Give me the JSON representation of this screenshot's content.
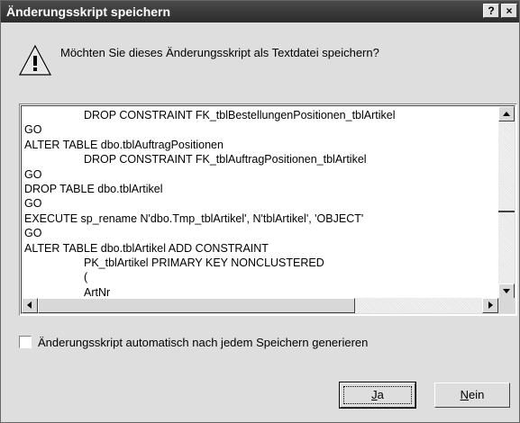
{
  "dialog": {
    "title": "Änderungsskript speichern",
    "help_label": "?",
    "close_label": "×",
    "message": "Möchten Sie dieses Änderungsskript als Textdatei speichern?"
  },
  "script_lines": [
    {
      "text": "DROP CONSTRAINT FK_tblBestellungenPositionen_tblArtikel",
      "indent": true
    },
    {
      "text": "GO",
      "indent": false
    },
    {
      "text": "ALTER TABLE dbo.tblAuftragPositionen",
      "indent": false
    },
    {
      "text": "DROP CONSTRAINT FK_tblAuftragPositionen_tblArtikel",
      "indent": true
    },
    {
      "text": "GO",
      "indent": false
    },
    {
      "text": "DROP TABLE dbo.tblArtikel",
      "indent": false
    },
    {
      "text": "GO",
      "indent": false
    },
    {
      "text": "EXECUTE sp_rename N'dbo.Tmp_tblArtikel', N'tblArtikel', 'OBJECT'",
      "indent": false
    },
    {
      "text": "GO",
      "indent": false
    },
    {
      "text": "ALTER TABLE dbo.tblArtikel ADD CONSTRAINT",
      "indent": false
    },
    {
      "text": "PK_tblArtikel PRIMARY KEY NONCLUSTERED",
      "indent": true
    },
    {
      "text": "(",
      "indent": true
    },
    {
      "text": "ArtNr",
      "indent": true
    }
  ],
  "checkbox": {
    "checked": false,
    "label_before": "Änderungsskript automatisch nach jedem Speichern ",
    "label_underlined": "g",
    "label_after": "enerieren"
  },
  "buttons": {
    "yes": {
      "u": "J",
      "rest": "a"
    },
    "no": {
      "u": "N",
      "rest": "ein"
    }
  },
  "icons": {
    "warning": "warning-icon"
  }
}
